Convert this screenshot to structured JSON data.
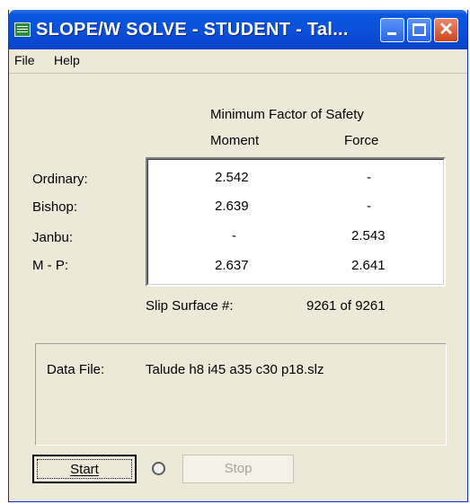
{
  "window": {
    "title": "SLOPE/W SOLVE - STUDENT - Tal...",
    "controls": {
      "minimize": "minimize",
      "maximize": "maximize",
      "close": "✕"
    }
  },
  "menu": {
    "items": [
      "File",
      "Help"
    ]
  },
  "results": {
    "header": "Minimum Factor of Safety",
    "columns": [
      "Moment",
      "Force"
    ],
    "rows": [
      {
        "method": "Ordinary:",
        "moment": "2.542",
        "force": "-"
      },
      {
        "method": "Bishop:",
        "moment": "2.639",
        "force": "-"
      },
      {
        "method": "Janbu:",
        "moment": "-",
        "force": "2.543"
      },
      {
        "method": "M - P:",
        "moment": "2.637",
        "force": "2.641"
      }
    ],
    "slip_surface_label": "Slip Surface #:",
    "slip_surface_value": "9261 of 9261"
  },
  "data_file": {
    "label": "Data File:",
    "value": "Talude h8 i45 a35 c30 p18.slz"
  },
  "buttons": {
    "start": "Start",
    "stop": "Stop"
  },
  "colors": {
    "titlebar": "#0b4fd8",
    "close_button": "#c9461f",
    "dialog_bg": "#ece9d8"
  }
}
